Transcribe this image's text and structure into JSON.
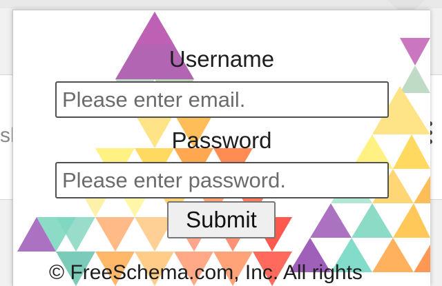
{
  "background": {
    "partial_text": "sh"
  },
  "login": {
    "username_label": "Username",
    "username_placeholder": "Please enter email.",
    "password_label": "Password",
    "password_placeholder": "Please enter password.",
    "submit_label": "Submit"
  },
  "footer": {
    "copyright": "© FreeSchema.com, Inc. All rights"
  },
  "colors": {
    "popup_bg": "#ffffff",
    "field_border": "#505050",
    "button_bg": "#efefef",
    "triangle_purple": "#9b59b6",
    "triangle_orange": "#ff9f43",
    "triangle_yellow": "#fde74c",
    "triangle_teal": "#76d7c4",
    "triangle_red": "#ff3b30"
  }
}
